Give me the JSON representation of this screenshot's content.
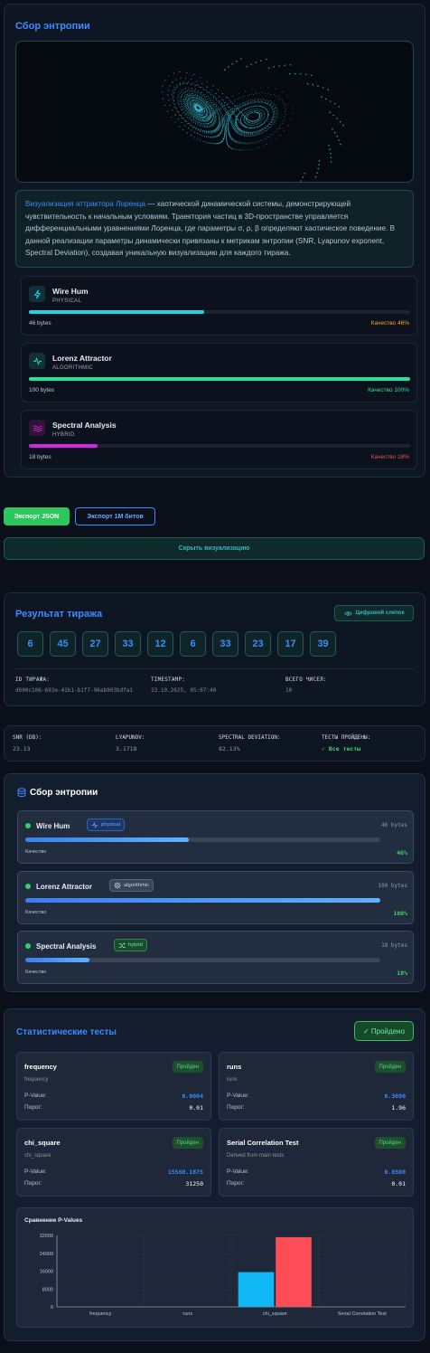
{
  "entropy_panel": {
    "title": "Сбор энтропии",
    "desc_highlight": "Визуализация аттрактора Лоренца",
    "desc_rest": " — хаотической динамической системы, демонстрирующей чувствительность к начальным условиям. Траектория частиц в 3D-пространстве управляется дифференциальными уравнениями Лоренца, где параметры σ, ρ, β определяют хаотическое поведение. В данной реализации параметры динамически привязаны к метрикам энтропии (SNR, Lyapunov exponent, Spectral Deviation), создавая уникальную визуализацию для каждого тиража.",
    "sources": [
      {
        "name": "Wire Hum",
        "type": "PHYSICAL",
        "bytes": "46 bytes",
        "quality": "Качество 46%",
        "level": 0.46,
        "color": "#22d3e6",
        "quality_color": "#f5a524",
        "icon": "lightning-icon"
      },
      {
        "name": "Lorenz Attractor",
        "type": "ALGORITHMIC",
        "bytes": "100 bytes",
        "quality": "Качество 100%",
        "level": 1.0,
        "color": "#22e39a",
        "quality_color": "#31e08a",
        "icon": "pulse-icon"
      },
      {
        "name": "Spectral Analysis",
        "type": "HYBRID",
        "bytes": "18 bytes",
        "quality": "Качество 18%",
        "level": 0.18,
        "color": "#d326e0",
        "quality_color": "#f0504a",
        "icon": "wave-icon"
      }
    ]
  },
  "actions": {
    "export_json": "Экспорт JSON",
    "export_1m": "Экспорт 1M битов",
    "hide_viz": "Скрыть визуализацию"
  },
  "draw_result": {
    "title": "Результат тиража",
    "snapshot_button": "Цифровой слепок",
    "numbers": [
      "6",
      "45",
      "27",
      "33",
      "12",
      "6",
      "33",
      "23",
      "17",
      "39"
    ],
    "meta": [
      {
        "label": "ID ТИРАЖА:",
        "value": "d600c106-693e-41b1-b1f7-96ab903bdfa1"
      },
      {
        "label": "TIMESTAMP:",
        "value": "23.10.2025, 05:07:40"
      },
      {
        "label": "ВСЕГО ЧИСЕЛ:",
        "value": "10"
      }
    ]
  },
  "metrics": [
    {
      "label": "SNR (DB):",
      "value": "23.13"
    },
    {
      "label": "LYAPUNOV:",
      "value": "3.1718"
    },
    {
      "label": "SPECTRAL DEVIATION:",
      "value": "82.13%"
    },
    {
      "label": "ТЕСТЫ ПРОЙДЕНЫ:",
      "value": "✓ Все тесты"
    }
  ],
  "entropy_collection": {
    "title": "Сбор энтропии",
    "quality_label": "Качество",
    "sources": [
      {
        "name": "Wire Hum",
        "badge": "physical",
        "bytes": "46 bytes",
        "quality": "46%",
        "level": 0.46,
        "badge_color": "#3b8cff"
      },
      {
        "name": "Lorenz Attractor",
        "badge": "algorithmic",
        "bytes": "100 bytes",
        "quality": "100%",
        "level": 1.0,
        "badge_color": "#b8c6d4"
      },
      {
        "name": "Spectral Analysis",
        "badge": "hybrid",
        "bytes": "18 bytes",
        "quality": "18%",
        "level": 0.18,
        "badge_color": "#4fdb79"
      }
    ]
  },
  "stat_tests": {
    "title": "Статистические тесты",
    "status_button": "✓ Пройдено",
    "pvalue_label": "P-Value:",
    "threshold_label": "Порог:",
    "tests": [
      {
        "name": "frequency",
        "sub": "frequency",
        "badge": "Пройден",
        "pvalue": "0.0004",
        "threshold": "0.01"
      },
      {
        "name": "runs",
        "sub": "runs",
        "badge": "Пройден",
        "pvalue": "0.3690",
        "threshold": "1.96"
      },
      {
        "name": "chi_square",
        "sub": "chi_square",
        "badge": "Пройден",
        "pvalue": "15568.1875",
        "threshold": "31250"
      },
      {
        "name": "Serial Correlation Test",
        "sub": "Derived from main tests",
        "badge": "Пройден",
        "pvalue": "0.8500",
        "threshold": "0.01"
      }
    ]
  },
  "chart_data": {
    "type": "bar",
    "title": "Сравнение P-Values",
    "categories": [
      "frequency",
      "runs",
      "chi_square",
      "Serial Correlation Test"
    ],
    "series": [
      {
        "values": [
          0.0004,
          0.369,
          15568.1875,
          0.85
        ],
        "color": "#10b9f5"
      },
      {
        "values": [
          0.01,
          1.96,
          31250,
          0.01
        ],
        "color": "#ff4d57"
      }
    ],
    "yticks": [
      0,
      8000,
      16000,
      24000,
      32000
    ],
    "ylim": [
      0,
      32000
    ],
    "grid": true
  },
  "colors": {
    "accent": "#3b8cff",
    "success": "#2dc65c",
    "teal": "#3fb1c4"
  }
}
